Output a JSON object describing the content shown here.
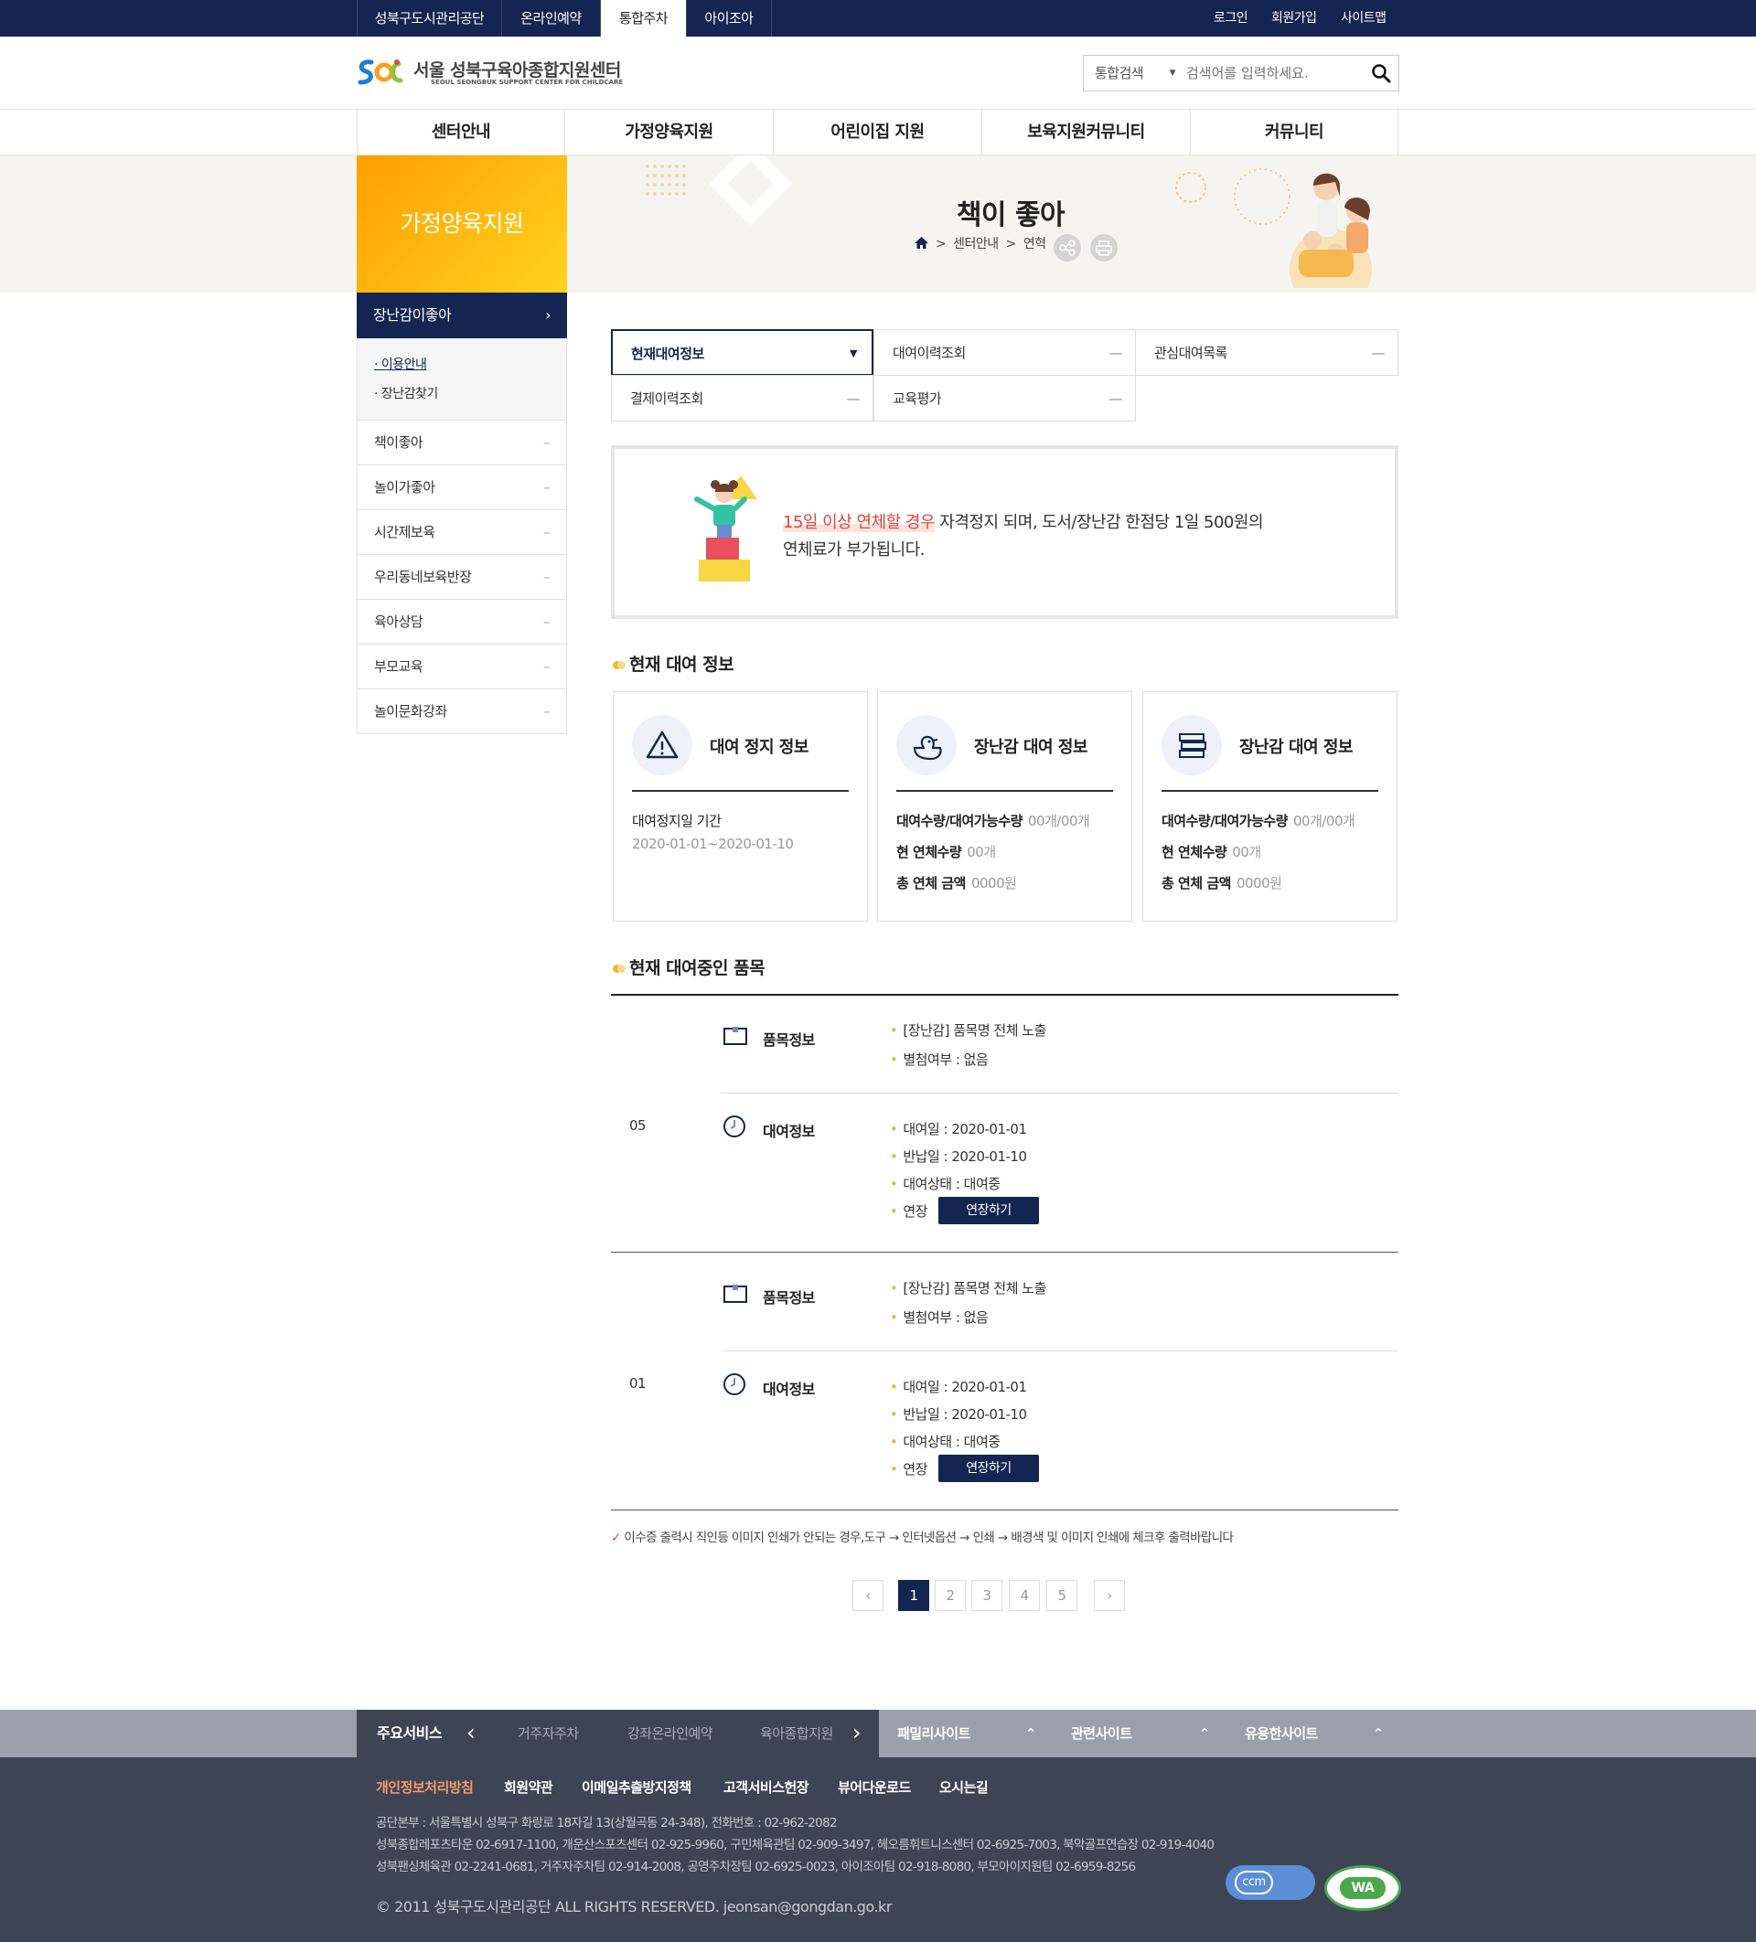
{
  "topbar": {
    "links": [
      "성북구도시관리공단",
      "온라인예약",
      "통합주차",
      "아이조아"
    ],
    "active_index": 2,
    "util": [
      "로그인",
      "회원가입",
      "사이트맵"
    ]
  },
  "header": {
    "logo_title": "서울 성북구육아종합지원센터",
    "logo_sub": "SEOUL SEONGBUK SUPPORT CENTER FOR CHILDCARE",
    "search_select": "통합검색",
    "search_placeholder": "검색어를 입력하세요."
  },
  "gnb": [
    "센터안내",
    "가정양육지원",
    "어린이집 지원",
    "보육지원커뮤니티",
    "커뮤니티"
  ],
  "visual": {
    "side_title": "가정양육지원",
    "page_title": "책이 좋아",
    "breadcrumb": [
      "센터안내",
      "연혁"
    ]
  },
  "sidebar": {
    "active": "장난감이좋아",
    "sub": [
      "이용안내",
      "장난감찾기"
    ],
    "items": [
      "책이좋아",
      "놀이가좋아",
      "시간제보육",
      "우리동네보육반장",
      "육아상담",
      "부모교육",
      "놀이문화강좌"
    ]
  },
  "tabs": [
    "현재대여정보",
    "대여이력조회",
    "관심대여목록",
    "결제이력조회",
    "교육평가"
  ],
  "notice": {
    "highlight": "15일 이상 연체할 경우",
    "text1": " 자격정지 되며, 도서/장난감 한점당 1일 500원의",
    "text2": "연체료가 부가됩니다."
  },
  "section1_title": "현재 대여 정보",
  "cards": [
    {
      "icon": "warning-icon",
      "title": "대여 정지 정보",
      "rows": [
        {
          "label": "대여정지일 기간",
          "value": ""
        }
      ],
      "period": "2020-01-01~2020-01-10"
    },
    {
      "icon": "duck-toy-icon",
      "title": "장난감 대여 정보",
      "rows": [
        {
          "label": "대여수량/대여가능수량",
          "value": "00개/00개"
        },
        {
          "label": "현 연체수량",
          "value": "00개"
        },
        {
          "label": "총 연체 금액",
          "value": "0000원"
        }
      ]
    },
    {
      "icon": "books-icon",
      "title": "장난감 대여 정보",
      "rows": [
        {
          "label": "대여수량/대여가능수량",
          "value": "00개/00개"
        },
        {
          "label": "현 연체수량",
          "value": "00개"
        },
        {
          "label": "총 연체 금액",
          "value": "0000원"
        }
      ]
    }
  ],
  "section2_title": "현재 대여중인 품목",
  "rentals": [
    {
      "no": "05",
      "item_label": "품목정보",
      "item_name": "[장난감] 품목명 전체 노출",
      "attach": "별첨여부 : 없음",
      "rent_label": "대여정보",
      "rent_date": "대여일 : 2020-01-01",
      "return_date": "반납일 : 2020-01-10",
      "status": "대여상태 : 대여중",
      "extend_label": "연장",
      "extend_btn": "연장하기"
    },
    {
      "no": "01",
      "item_label": "품목정보",
      "item_name": "[장난감] 품목명 전체 노출",
      "attach": "별첨여부 : 없음",
      "rent_label": "대여정보",
      "rent_date": "대여일 : 2020-01-01",
      "return_date": "반납일 : 2020-01-10",
      "status": "대여상태 : 대여중",
      "extend_label": "연장",
      "extend_btn": "연장하기"
    }
  ],
  "print_note": "이수증 출력시 직인등 이미지 인쇄가 안되는 경우,도구 → 인터넷옵션 → 인쇄 → 배경색 및 이미지 인쇄에 체크후 출력바랍니다",
  "pagination": {
    "pages": [
      "1",
      "2",
      "3",
      "4",
      "5"
    ],
    "current": "1"
  },
  "footer": {
    "main_service": "주요서비스",
    "services": [
      "거주자주차",
      "강좌온라인예약",
      "육아종합지원"
    ],
    "family": "패밀리사이트",
    "related": "관련사이트",
    "useful": "유용한사이트",
    "links": [
      "개인정보처리방침",
      "회원약관",
      "이메일추출방지정책",
      "고객서비스헌장",
      "뷰어다운로드",
      "오시는길"
    ],
    "addr1": "공단본부 : 서울특별시 성북구 화랑로 18자길 13(상월곡동 24-348), 전화번호 : 02-962-2082",
    "addr2": "성북종합레포츠타운 02-6917-1100, 개운산스포츠센터 02-925-9960, 구민체육관팀 02-909-3497, 헤오름휘트니스센터 02-6925-7003, 북악골프연습장 02-919-4040",
    "addr3": "성북팬싱체육관 02-2241-0681, 거주자주차팀 02-914-2008, 공영주차장팀 02-6925-0023, 아이조아팀 02-918-8080, 부모아이지원팀 02-6959-8256",
    "copyright": "© 2011 성북구도시관리공단 ALL RIGHTS RESERVED. jeonsan@gongdan.go.kr",
    "badge1": "ccm",
    "badge2": "WA"
  },
  "colors": {
    "navy": "#142551",
    "accent_orange": "#ffa600",
    "highlight_red": "#e8423b",
    "bullet_yellow": "#f1b92f"
  }
}
